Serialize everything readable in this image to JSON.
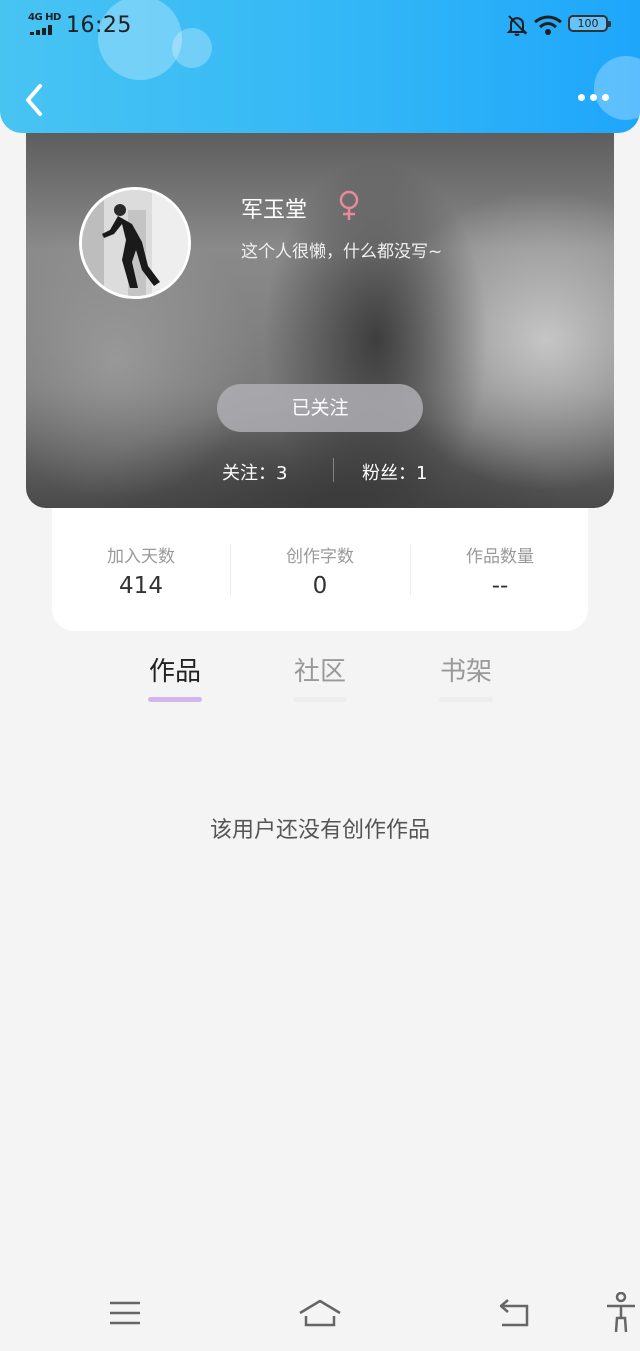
{
  "status_bar": {
    "network": "4G HD",
    "time": "16:25",
    "battery": "100"
  },
  "profile": {
    "name": "军玉堂",
    "gender_icon": "female-icon",
    "bio": "这个人很懒，什么都没写~",
    "follow_button": "已关注",
    "following": "关注：3",
    "fans": "粉丝：1"
  },
  "stats": [
    {
      "label": "加入天数",
      "value": "414"
    },
    {
      "label": "创作字数",
      "value": "0"
    },
    {
      "label": "作品数量",
      "value": "--"
    }
  ],
  "tabs": [
    {
      "label": "作品",
      "active": true
    },
    {
      "label": "社区",
      "active": false
    },
    {
      "label": "书架",
      "active": false
    }
  ],
  "empty_message": "该用户还没有创作作品",
  "colors": {
    "header_start": "#48c4f3",
    "header_end": "#1ea6fb",
    "tab_indicator": "#d2b6ea",
    "gender_icon": "#e98a9b"
  },
  "nav_bar_icons": [
    "menu-icon",
    "home-icon",
    "back-icon",
    "accessibility-icon"
  ]
}
